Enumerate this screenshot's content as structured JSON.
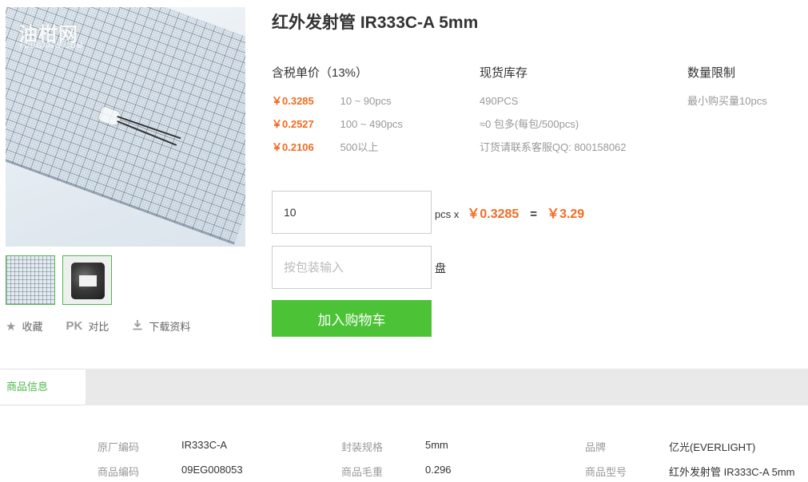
{
  "product": {
    "title": "红外发射管 IR333C-A 5mm",
    "watermark": "油柑网",
    "watermark_sub": "YOUGANW.COM"
  },
  "actions": {
    "favorite": "收藏",
    "compare_icon": "PK",
    "compare": "对比",
    "download": "下载资料"
  },
  "pricing": {
    "header": "含税单价（13%）",
    "tiers": [
      {
        "price": "￥0.3285",
        "range": "10 ~ 90pcs"
      },
      {
        "price": "￥0.2527",
        "range": "100 ~ 490pcs"
      },
      {
        "price": "￥0.2106",
        "range": "500以上"
      }
    ]
  },
  "stock": {
    "header": "现货库存",
    "lines": [
      "490PCS",
      "≈0 包多(每包/500pcs)",
      "订货请联系客服QQ: 800158062"
    ]
  },
  "limit": {
    "header": "数量限制",
    "text": "最小购买量10pcs"
  },
  "order": {
    "quantity_value": "10",
    "unit": "pcs x",
    "unit_price": "￥0.3285",
    "equals": "=",
    "total": "￥3.29",
    "pack_placeholder": "按包装输入",
    "pack_unit": "盘",
    "cart_button": "加入购物车"
  },
  "tabs": {
    "active": "商品信息"
  },
  "specs": {
    "rows": [
      [
        {
          "label": "原厂编码",
          "value": "IR333C-A"
        },
        {
          "label": "封装规格",
          "value": "5mm"
        },
        {
          "label": "品牌",
          "value": "亿光(EVERLIGHT)"
        }
      ],
      [
        {
          "label": "商品编码",
          "value": "09EG008053"
        },
        {
          "label": "商品毛重",
          "value": "0.296"
        },
        {
          "label": "商品型号",
          "value": "红外发射管 IR333C-A 5mm"
        }
      ]
    ]
  },
  "colors": {
    "price_orange": "#f26b21",
    "cart_green": "#4cc236",
    "tab_green": "#4bb84b"
  }
}
